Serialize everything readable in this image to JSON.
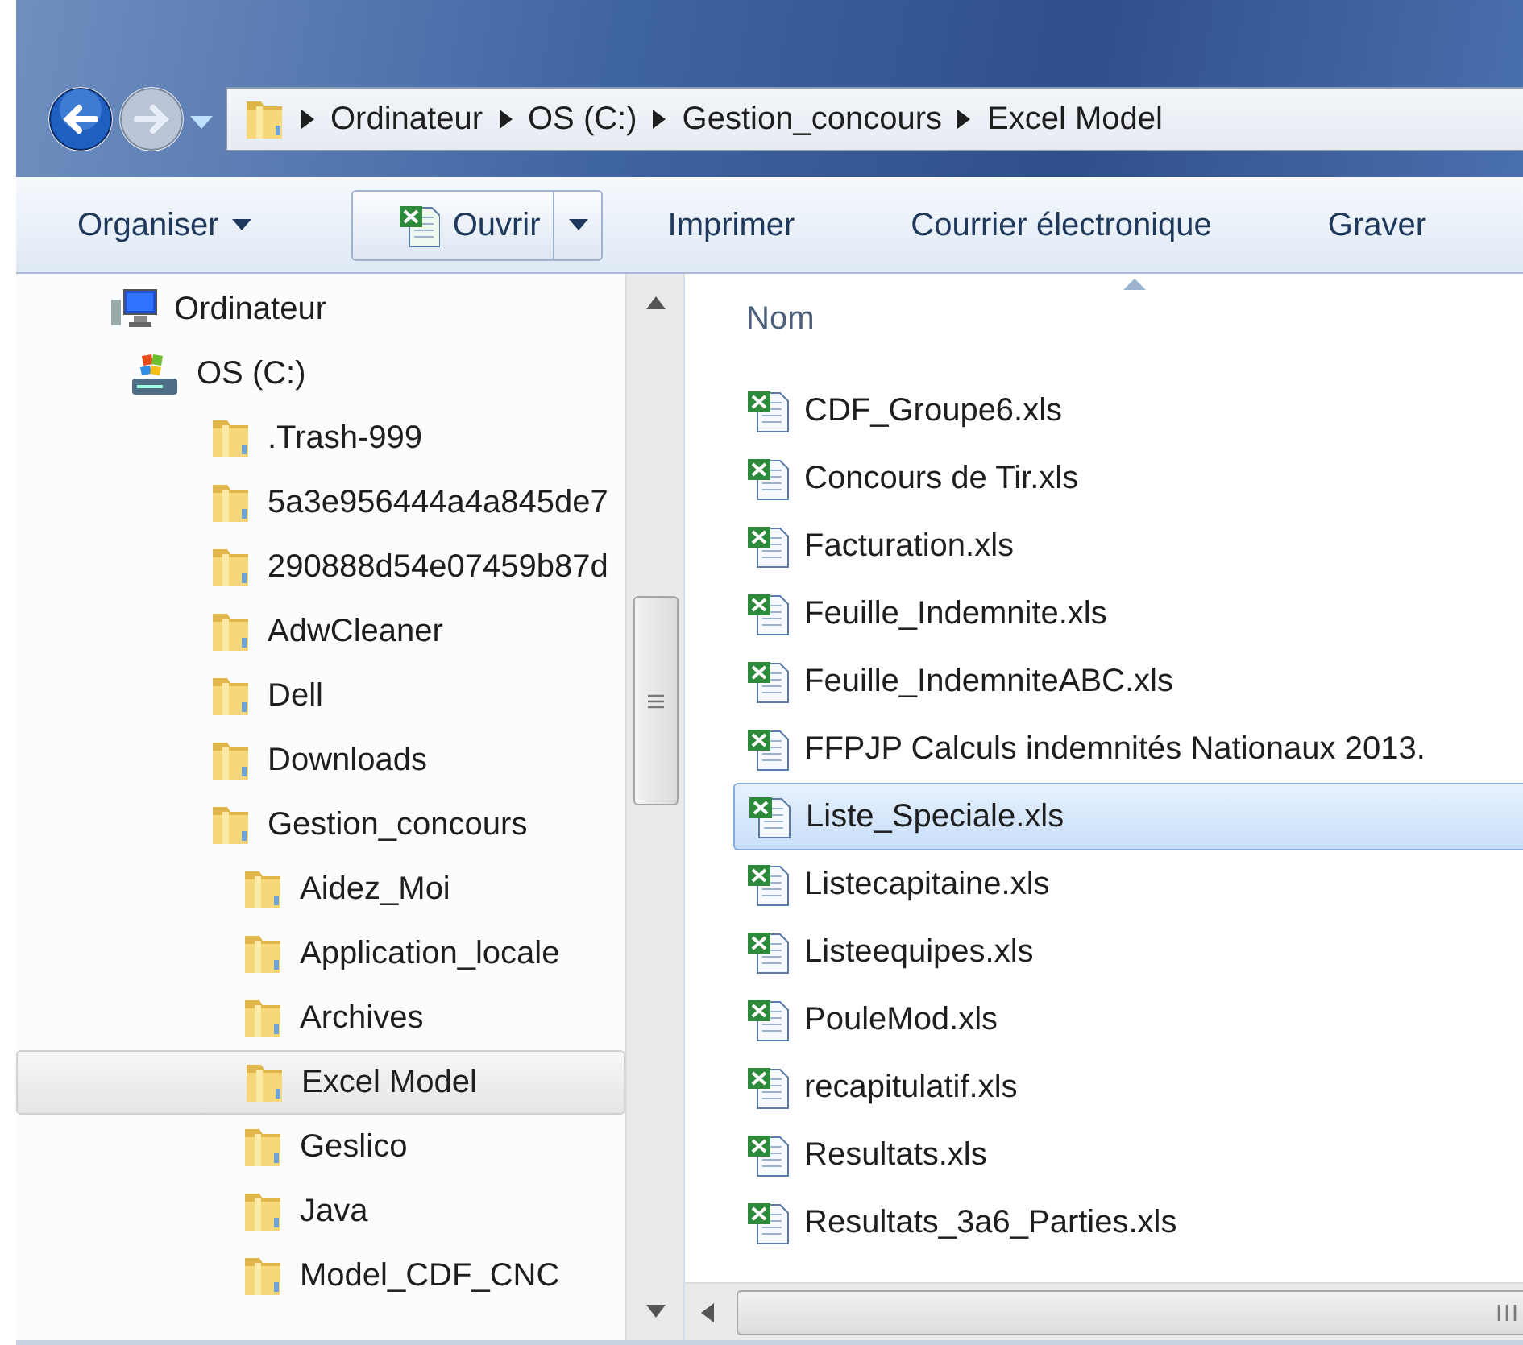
{
  "address_bar": {
    "crumbs": [
      "Ordinateur",
      "OS (C:)",
      "Gestion_concours",
      "Excel Model"
    ]
  },
  "toolbar": {
    "items": [
      {
        "kind": "menu",
        "label": "Organiser"
      },
      {
        "kind": "split",
        "label": "Ouvrir"
      },
      {
        "kind": "plain",
        "label": "Imprimer"
      },
      {
        "kind": "plain",
        "label": "Courrier électronique"
      },
      {
        "kind": "plain",
        "label": "Graver"
      }
    ]
  },
  "tree": {
    "items": [
      {
        "kind": "computer",
        "label": "Ordinateur",
        "selected": false,
        "children": [
          {
            "kind": "drive",
            "label": "OS (C:)",
            "selected": false,
            "children": [
              {
                "kind": "folder",
                "label": ".Trash-999",
                "selected": false
              },
              {
                "kind": "folder",
                "label": "5a3e956444a4a845de7",
                "selected": false
              },
              {
                "kind": "folder",
                "label": "290888d54e07459b87d",
                "selected": false
              },
              {
                "kind": "folder",
                "label": "AdwCleaner",
                "selected": false
              },
              {
                "kind": "folder",
                "label": "Dell",
                "selected": false
              },
              {
                "kind": "folder",
                "label": "Downloads",
                "selected": false
              },
              {
                "kind": "folder",
                "label": "Gestion_concours",
                "selected": false,
                "children": [
                  {
                    "kind": "folder",
                    "label": "Aidez_Moi",
                    "selected": false
                  },
                  {
                    "kind": "folder",
                    "label": "Application_locale",
                    "selected": false
                  },
                  {
                    "kind": "folder",
                    "label": "Archives",
                    "selected": false
                  },
                  {
                    "kind": "folder",
                    "label": "Excel Model",
                    "selected": true
                  },
                  {
                    "kind": "folder",
                    "label": "Geslico",
                    "selected": false
                  },
                  {
                    "kind": "folder",
                    "label": "Java",
                    "selected": false
                  },
                  {
                    "kind": "folder",
                    "label": "Model_CDF_CNC",
                    "selected": false
                  }
                ]
              }
            ]
          }
        ]
      }
    ]
  },
  "file_list": {
    "column": "Nom",
    "files": [
      {
        "name": "CDF_Groupe6.xls",
        "selected": false
      },
      {
        "name": "Concours de Tir.xls",
        "selected": false
      },
      {
        "name": "Facturation.xls",
        "selected": false
      },
      {
        "name": "Feuille_Indemnite.xls",
        "selected": false
      },
      {
        "name": "Feuille_IndemniteABC.xls",
        "selected": false
      },
      {
        "name": "FFPJP Calculs indemnités Nationaux 2013.",
        "selected": false
      },
      {
        "name": "Liste_Speciale.xls",
        "selected": true
      },
      {
        "name": "Listecapitaine.xls",
        "selected": false
      },
      {
        "name": "Listeequipes.xls",
        "selected": false
      },
      {
        "name": "PouleMod.xls",
        "selected": false
      },
      {
        "name": "recapitulatif.xls",
        "selected": false
      },
      {
        "name": "Resultats.xls",
        "selected": false
      },
      {
        "name": "Resultats_3a6_Parties.xls",
        "selected": false
      }
    ]
  }
}
